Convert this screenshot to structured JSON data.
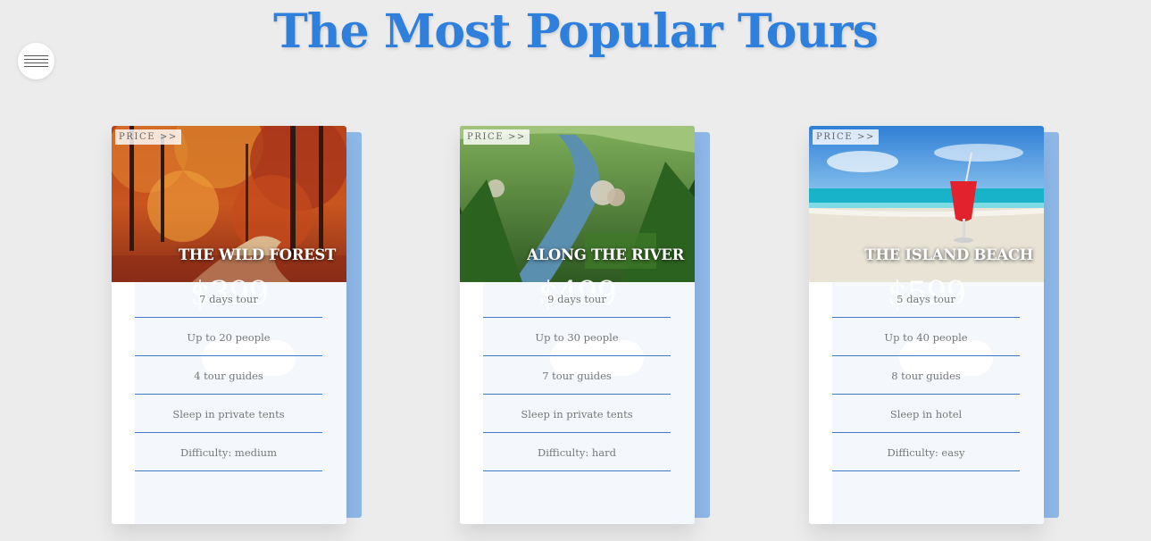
{
  "page": {
    "title": "The Most Popular Tours"
  },
  "menu": {
    "icon": "hamburger-icon"
  },
  "colors": {
    "title": "#2f80dc",
    "card_back": "#8db8e8",
    "divider": "#3f7bc4",
    "background": "#ececec"
  },
  "tours": [
    {
      "price_tag": "PRICE >>",
      "name": "THE WILD FOREST",
      "price": "$399",
      "image": "autumn-forest-image",
      "details": [
        "7 days tour",
        "Up to 20 people",
        "4 tour guides",
        "Sleep in private tents",
        "Difficulty: medium"
      ]
    },
    {
      "price_tag": "PRICE >>",
      "name": "ALONG THE RIVER",
      "price": "$499",
      "image": "river-valley-image",
      "details": [
        "9 days tour",
        "Up to 30 people",
        "7 tour guides",
        "Sleep in private tents",
        "Difficulty: hard"
      ]
    },
    {
      "price_tag": "PRICE >>",
      "name": "THE ISLAND BEACH",
      "price": "$599",
      "image": "beach-cocktail-image",
      "details": [
        "5 days tour",
        "Up to 40 people",
        "8 tour guides",
        "Sleep in hotel",
        "Difficulty: easy"
      ]
    }
  ]
}
